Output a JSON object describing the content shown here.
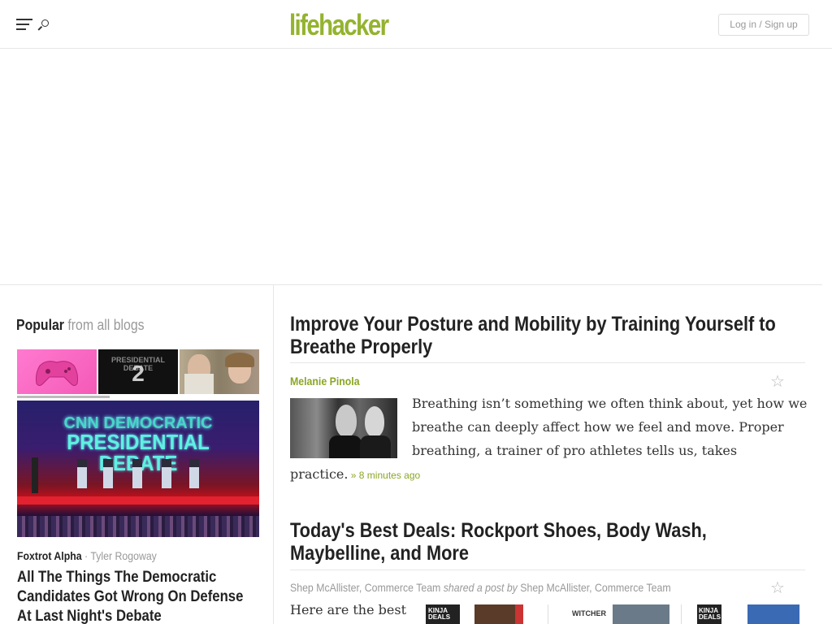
{
  "header": {
    "logo": "lifehacker",
    "login_label": "Log in / Sign up",
    "logo_color": "#94b330"
  },
  "sidebar": {
    "heading_strong": "Popular",
    "heading_muted": " from all blogs",
    "thumb_2_number": "2",
    "featured_image_text_1": "CNN DEMOCRATIC",
    "featured_image_text_2": "PRESIDENTIAL DEBATE",
    "featured_blog": "Foxtrot Alpha",
    "featured_sep": " · ",
    "featured_author": "Tyler Rogoway",
    "featured_headline": "All The Things The Democratic Candidates Got Wrong On Defense At Last Night's Debate"
  },
  "articles": [
    {
      "title": "Improve Your Posture and Mobility by Training Yourself to Breathe Properly",
      "author": "Melanie Pinola",
      "excerpt_wrapped": "Breathing isn’t something we often think about, yet how we breathe can deeply affect how we feel and move. Proper breathing, a trainer of pro athletes tells us, takes",
      "excerpt_tail": "practice.",
      "time": " » 8 minutes ago"
    },
    {
      "title": "Today's Best Deals: Rockport Shoes, Body Wash, Maybelline, and More",
      "author_name": "Shep McAllister, Commerce Team",
      "shared_text": " shared a post by ",
      "shared_author": "Shep McAllister, Commerce Team",
      "excerpt": "Here are the best",
      "deal_label_1": "KINJA DEALS",
      "deal_label_2": "WITCHER",
      "deal_label_3": "KINJA DEALS"
    }
  ],
  "icons": {
    "menu": "hamburger-menu-icon",
    "search": "search-icon",
    "star": "☆"
  },
  "colors": {
    "accent_green": "#8aa624",
    "muted_gray": "#999999"
  }
}
